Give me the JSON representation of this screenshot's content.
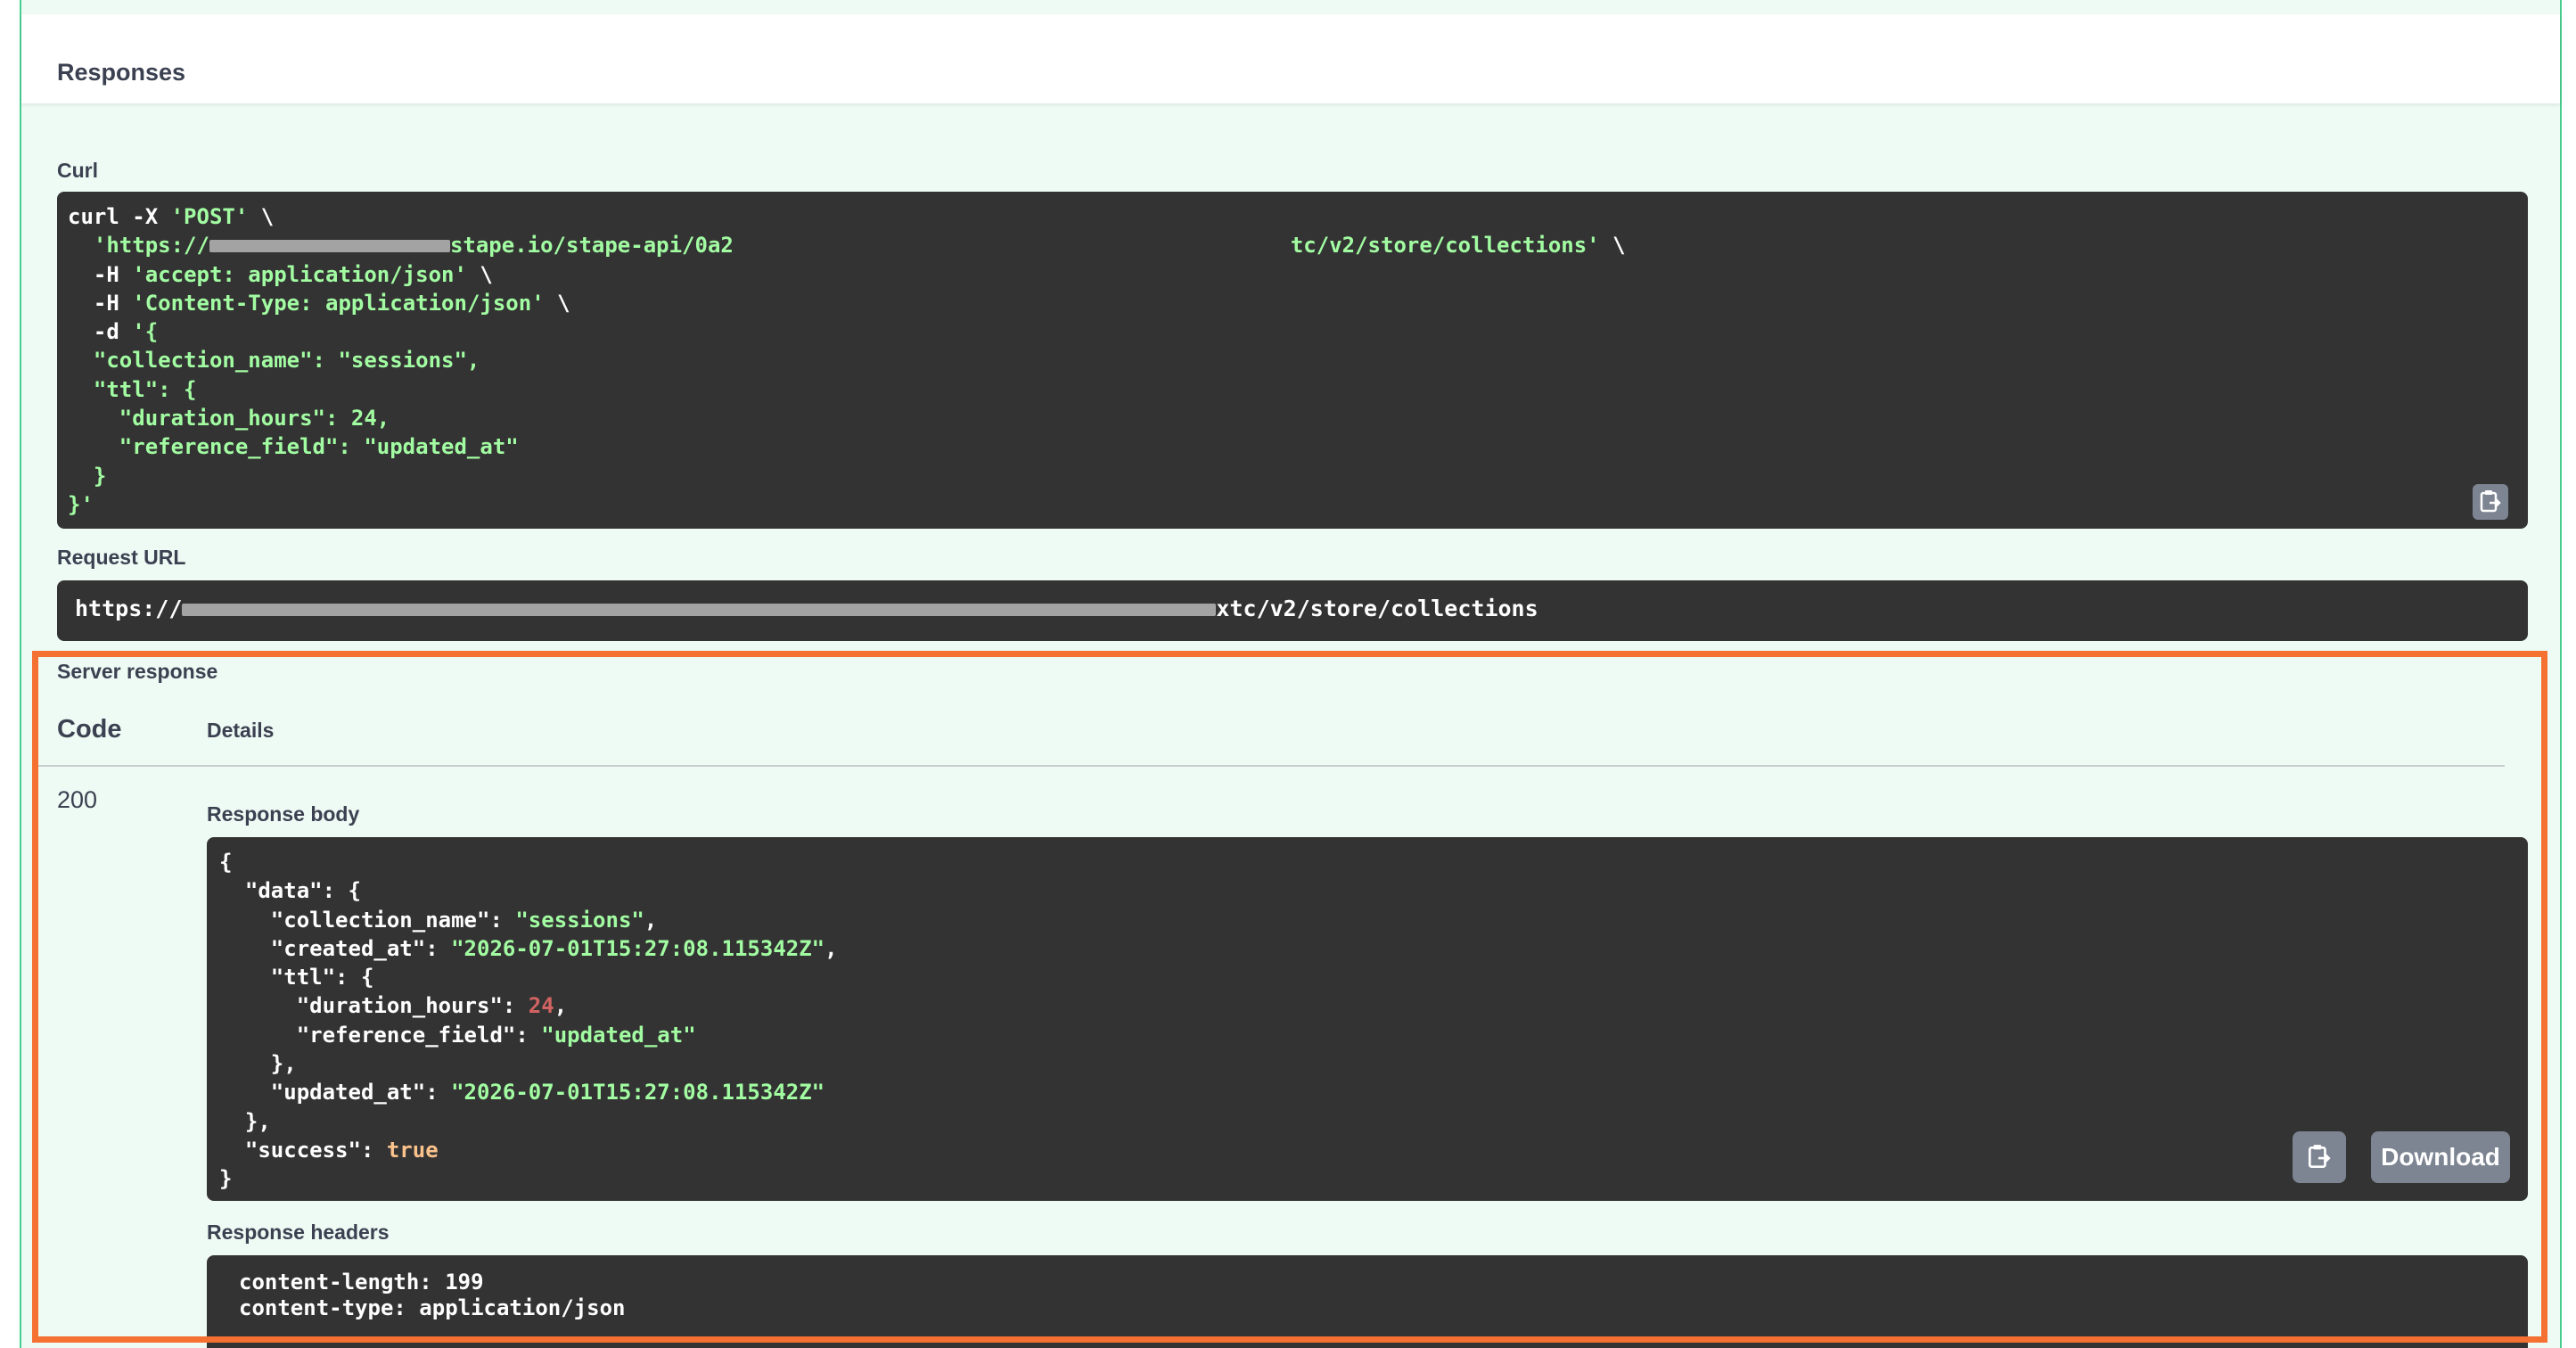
{
  "responses": {
    "title": "Responses"
  },
  "curl": {
    "label": "Curl",
    "line1": "curl -X ",
    "line1_method": "'POST'",
    "line1_end": " \\",
    "line2_start": "'https://",
    "line2_mid": "stape.io/stape-api/0a2",
    "line2_end": "tc/v2/store/collections'",
    "line2_tail": " \\",
    "line3_flag": "-H ",
    "line3_str": "'accept: application/json'",
    "line3_end": " \\",
    "line4_flag": "-H ",
    "line4_str": "'Content-Type: application/json'",
    "line4_end": " \\",
    "line5_flag": "-d ",
    "line5_str": "'{",
    "line6": "\"collection_name\": \"sessions\",",
    "line7": "\"ttl\": {",
    "line8": "\"duration_hours\": 24,",
    "line9": "\"reference_field\": \"updated_at\"",
    "line10": "}",
    "line11": "}'"
  },
  "request_url": {
    "label": "Request URL",
    "start": "https://",
    "end": "xtc/v2/store/collections"
  },
  "server_response": {
    "label": "Server response",
    "code_header": "Code",
    "details_header": "Details",
    "code": "200",
    "body_label": "Response body",
    "headers_label": "Response headers",
    "download_label": "Download",
    "body": {
      "open": "{",
      "data_key": "\"data\"",
      "data_open": ": {",
      "collection_name_key": "\"collection_name\"",
      "collection_name_val": "\"sessions\"",
      "created_at_key": "\"created_at\"",
      "created_at_val": "\"2026-07-01T15:27:08.115342Z\"",
      "ttl_key": "\"ttl\"",
      "ttl_open": ": {",
      "duration_hours_key": "\"duration_hours\"",
      "duration_hours_val": "24",
      "reference_field_key": "\"reference_field\"",
      "reference_field_val": "\"updated_at\"",
      "ttl_close": "},",
      "updated_at_key": "\"updated_at\"",
      "updated_at_val": "\"2026-07-01T15:27:08.115342Z\"",
      "data_close": "},",
      "success_key": "\"success\"",
      "success_val": "true",
      "close": "}"
    },
    "headers": {
      "content_length": "content-length: 199",
      "content_type": "content-type: application/json"
    }
  },
  "colors": {
    "accent_green": "#49cc90",
    "panel_bg": "#eefaf4",
    "code_bg": "#333333",
    "string_green": "#a2fca2",
    "highlight_orange": "#f47132"
  }
}
